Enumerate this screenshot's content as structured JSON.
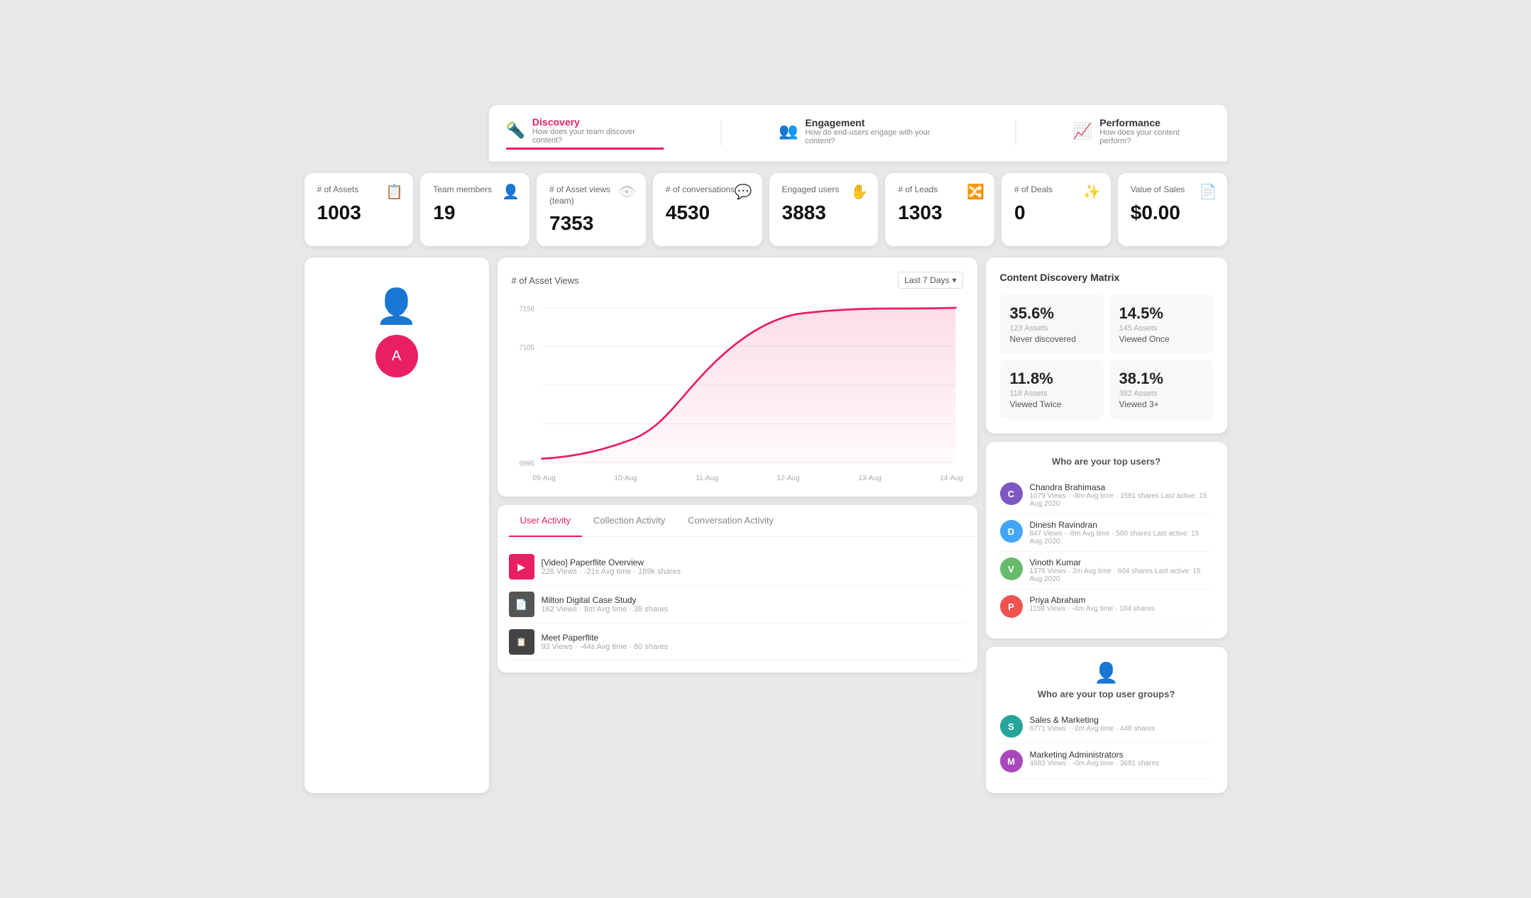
{
  "nav": {
    "tabs": [
      {
        "id": "discovery",
        "title": "Discovery",
        "subtitle": "How does your team discover content?",
        "active": true
      },
      {
        "id": "engagement",
        "title": "Engagement",
        "subtitle": "How do end-users engage with your content?",
        "active": false
      },
      {
        "id": "performance",
        "title": "Performance",
        "subtitle": "How does your content perform?",
        "active": false
      }
    ]
  },
  "metrics": [
    {
      "label": "# of Assets",
      "value": "1003",
      "icon": "📋"
    },
    {
      "label": "Team members",
      "value": "19",
      "icon": "👤"
    },
    {
      "label": "# of Asset views (team)",
      "value": "7353",
      "icon": "👁"
    },
    {
      "label": "# of conversations",
      "value": "4530",
      "icon": "💬"
    },
    {
      "label": "Engaged users",
      "value": "3883",
      "icon": "✋"
    },
    {
      "label": "# of Leads",
      "value": "1303",
      "icon": "🔀"
    },
    {
      "label": "# of Deals",
      "value": "0",
      "icon": "✨"
    },
    {
      "label": "Value of Sales",
      "value": "$0.00",
      "icon": "📄"
    }
  ],
  "chart": {
    "title": "# of Asset Views",
    "filter": "Last 7 Days",
    "x_labels": [
      "09-Aug",
      "10-Aug",
      "11-Aug",
      "12-Aug",
      "13-Aug",
      "14-Aug"
    ],
    "y_max": "7158",
    "y_mid": "7105",
    "y_low": "6995"
  },
  "bottom_tabs": [
    {
      "label": "User Activity",
      "active": true
    },
    {
      "label": "Collection Activity",
      "active": false
    },
    {
      "label": "Conversation Activity",
      "active": false
    }
  ],
  "asset_list": [
    {
      "name": "[Video] Paperflite Overview",
      "stats": "228 Views · -21s Avg time · 189k shares",
      "type": "video"
    },
    {
      "name": "Milton Digital Case Study",
      "stats": "162 Views · 8m Avg time · 38 shares",
      "type": "doc"
    },
    {
      "name": "Meet Paperflite",
      "stats": "93 Views · -44s Avg time · 80 shares",
      "type": "pdf"
    }
  ],
  "discovery_matrix": {
    "title": "Content Discovery Matrix",
    "cells": [
      {
        "pct": "35.6%",
        "assets": "123 Assets",
        "label": "Never discovered"
      },
      {
        "pct": "14.5%",
        "assets": "145 Assets",
        "label": "Viewed Once"
      },
      {
        "pct": "11.8%",
        "assets": "118 Assets",
        "label": "Viewed Twice"
      },
      {
        "pct": "38.1%",
        "assets": "382 Assets",
        "label": "Viewed 3+"
      }
    ]
  },
  "top_users": {
    "title": "Who are your top users?",
    "users": [
      {
        "name": "Chandra Brahimasa",
        "stats": "1079 Views · -8m Avg time · 1581 shares\nLast active: 15 Aug 2020",
        "color": "#7e57c2",
        "initial": "C"
      },
      {
        "name": "Dinesh Ravindran",
        "stats": "847 Views · -8m Avg time · 580 shares\nLast active: 15 Aug 2020",
        "color": "#42a5f5",
        "initial": "D"
      },
      {
        "name": "Vinoth Kumar",
        "stats": "1376 Views · 2m Avg time · 604 shares\nLast active: 15 Aug 2020",
        "color": "#66bb6a",
        "initial": "V"
      },
      {
        "name": "Priya Abraham",
        "stats": "1158 Views · -4m Avg time · 104 shares",
        "color": "#ef5350",
        "initial": "P"
      }
    ]
  },
  "top_groups": {
    "title": "Who are your top user groups?",
    "icon": "👤",
    "groups": [
      {
        "name": "Sales & Marketing",
        "stats": "6771 Views · -2m Avg time · 448 shares",
        "color": "#26a69a",
        "initial": "S"
      },
      {
        "name": "Marketing Administrators",
        "stats": "4683 Views · -0m Avg time · 3681 shares",
        "color": "#ab47bc",
        "initial": "M"
      }
    ]
  }
}
